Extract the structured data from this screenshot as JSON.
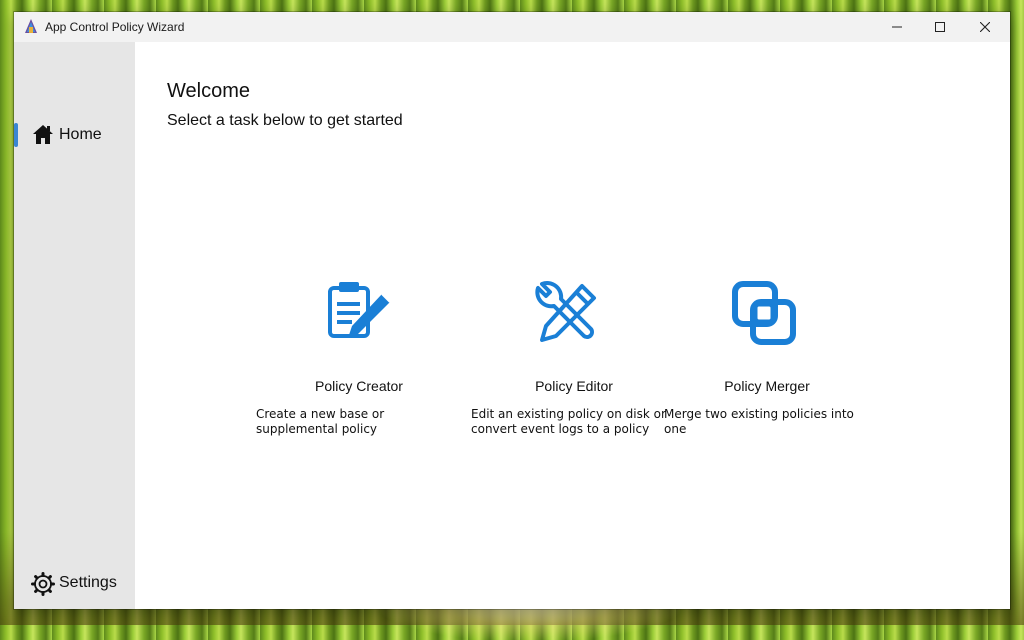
{
  "window": {
    "title": "App Control Policy Wizard",
    "controls": {
      "minimize": "minimize-icon",
      "maximize": "maximize-icon",
      "close": "close-icon"
    }
  },
  "sidebar": {
    "items": [
      {
        "label": "Home",
        "icon": "home-icon",
        "selected": true
      },
      {
        "label": "Settings",
        "icon": "gear-icon",
        "selected": false
      }
    ],
    "accent_color": "#3a86d4"
  },
  "main": {
    "heading": "Welcome",
    "subheading": "Select a task below to get started",
    "cards": [
      {
        "title": "Policy Creator",
        "description": "Create a new base or supplemental policy",
        "icon": "clipboard-pencil-icon"
      },
      {
        "title": "Policy Editor",
        "description": "Edit an existing policy on disk or convert event logs to a policy",
        "icon": "wrench-pencil-icon"
      },
      {
        "title": "Policy Merger",
        "description": "Merge two existing policies into one",
        "icon": "merge-squares-icon"
      }
    ],
    "icon_color": "#1a7fd6"
  }
}
